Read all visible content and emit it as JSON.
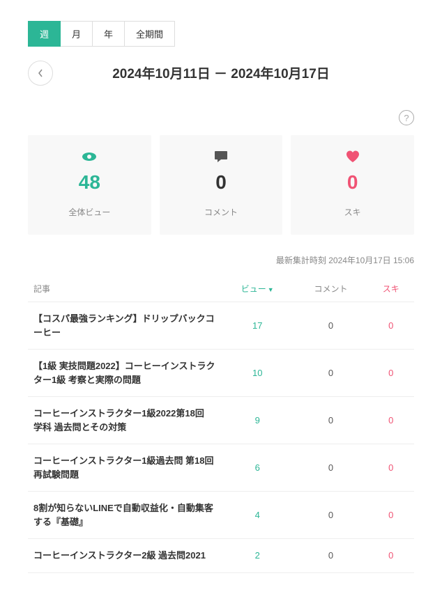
{
  "tabs": {
    "week": "週",
    "month": "月",
    "year": "年",
    "all": "全期間"
  },
  "date_range": "2024年10月11日 － 2024年10月17日",
  "help": "?",
  "stats": {
    "views": {
      "value": "48",
      "label": "全体ビュー"
    },
    "comments": {
      "value": "0",
      "label": "コメント"
    },
    "likes": {
      "value": "0",
      "label": "スキ"
    }
  },
  "timestamp": "最新集計時刻 2024年10月17日 15:06",
  "table": {
    "headers": {
      "article": "記事",
      "views": "ビュー",
      "comments": "コメント",
      "likes": "スキ"
    },
    "rows": [
      {
        "title": "【コスパ最強ランキング】ドリップバックコーヒー",
        "views": "17",
        "comments": "0",
        "likes": "0"
      },
      {
        "title": "【1級 実技問題2022】コーヒーインストラクター1級 考察と実際の問題",
        "views": "10",
        "comments": "0",
        "likes": "0"
      },
      {
        "title": "コーヒーインストラクター1級2022第18回 学科 過去問とその対策",
        "views": "9",
        "comments": "0",
        "likes": "0"
      },
      {
        "title": "コーヒーインストラクター1級過去問 第18回 再試験問題",
        "views": "6",
        "comments": "0",
        "likes": "0"
      },
      {
        "title": "8割が知らないLINEで自動収益化・自動集客する『基礎』",
        "views": "4",
        "comments": "0",
        "likes": "0"
      },
      {
        "title": "コーヒーインストラクター2級 過去問2021",
        "views": "2",
        "comments": "0",
        "likes": "0"
      }
    ]
  }
}
